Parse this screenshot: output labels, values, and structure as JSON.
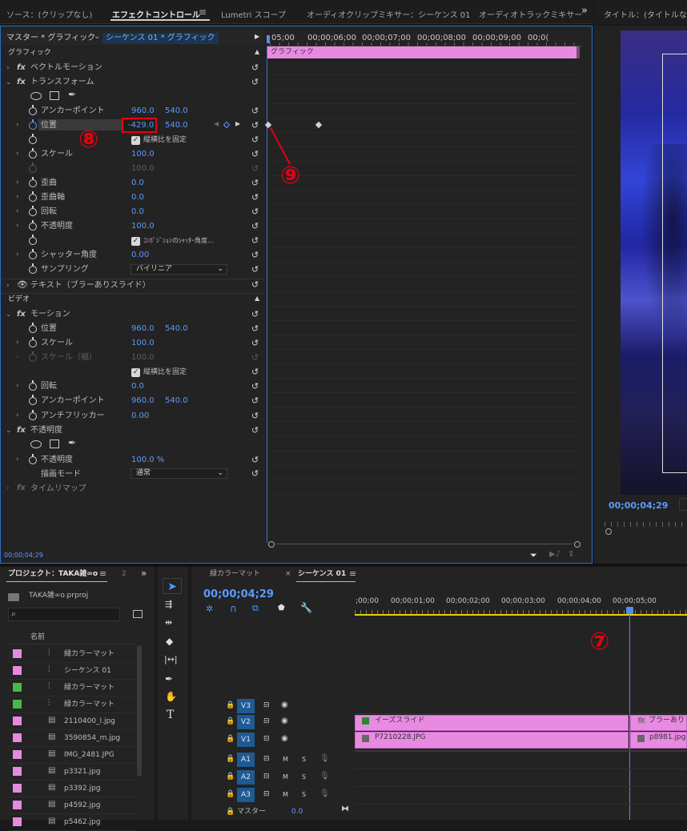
{
  "top_tabs": {
    "source": "ソース：(クリップなし)",
    "effect_controls": "エフェクトコントロール",
    "menu_glyph": "≡",
    "lumetri": "Lumetri スコープ",
    "audio_clip_mixer": "オーディオクリップミキサー：シーケンス 01",
    "audio_track_mixer": "オーディオトラックミキサー",
    "more": "»"
  },
  "program_tab": "タイトル：(タイトルなし)",
  "ec_header": {
    "master": "マスター * グラフィック",
    "chevron": "⌄",
    "sequence": "シーケンス 01 * グラフィック",
    "play_arrow": "▶"
  },
  "ec_ruler": [
    "05;00",
    "00;00;06;00",
    "00;00;07;00",
    "00;00;08;00",
    "00;00;09;00",
    "00;0("
  ],
  "graphic_clip_label": "グラフィック",
  "sections": {
    "graphic": "グラフィック",
    "video": "ビデオ"
  },
  "graphic_rows": {
    "vector_motion": "ベクトルモーション",
    "transform": "トランスフォーム",
    "anchor_point": {
      "label": "アンカーポイント",
      "x": "960.0",
      "y": "540.0"
    },
    "position": {
      "label": "位置",
      "x": "-429.0",
      "y": "540.0"
    },
    "uniform_scale": "縦横比を固定",
    "scale": {
      "label": "スケール",
      "value": "100.0"
    },
    "scale_width": {
      "value": "100.0"
    },
    "skew": {
      "label": "歪曲",
      "value": "0.0"
    },
    "skew_axis": {
      "label": "歪曲軸",
      "value": "0.0"
    },
    "rotation": {
      "label": "回転",
      "value": "0.0"
    },
    "opacity": {
      "label": "不透明度",
      "value": "100.0"
    },
    "composition_shutter": "ｺﾝﾎﾟｼﾞｼｮﾝのｼｬｯﾀｰ角度...",
    "shutter_angle": {
      "label": "シャッター角度",
      "value": "0.00"
    },
    "sampling": {
      "label": "サンプリング",
      "value": "バイリニア"
    },
    "text": "テキスト（ブラーありスライド）"
  },
  "video_rows": {
    "motion": "モーション",
    "position": {
      "label": "位置",
      "x": "960.0",
      "y": "540.0"
    },
    "scale": {
      "label": "スケール",
      "value": "100.0"
    },
    "scale_width": {
      "label": "スケール（幅）",
      "value": "100.0"
    },
    "uniform_scale": "縦横比を固定",
    "rotation": {
      "label": "回転",
      "value": "0.0"
    },
    "anchor_point": {
      "label": "アンカーポイント",
      "x": "960.0",
      "y": "540.0"
    },
    "anti_flicker": {
      "label": "アンチフリッカー",
      "value": "0.00"
    },
    "opacity_fx": "不透明度",
    "opacity": {
      "label": "不透明度",
      "value": "100.0 %"
    },
    "blend_mode": {
      "label": "描画モード",
      "value": "通常"
    },
    "time_remap": "タイムリマップ"
  },
  "ec_footer_time": "00;00;04;29",
  "program_timecode": "00;00;04;29",
  "project": {
    "tab": "プロジェクト：TAKA雑∞o",
    "menu": "≡",
    "file": "TAKA雑∞o.prproj",
    "column_name": "名前",
    "items": [
      {
        "name": "緑カラーマット",
        "color": "#e58ae0"
      },
      {
        "name": "シーケンス 01",
        "color": "#e58ae0"
      },
      {
        "name": "緑カラーマット",
        "color": "#49b849"
      },
      {
        "name": "緑カラーマット",
        "color": "#49b849"
      },
      {
        "name": "2110400_l.jpg",
        "color": "#e58ae0"
      },
      {
        "name": "3590854_m.jpg",
        "color": "#e58ae0"
      },
      {
        "name": "IMG_2481.JPG",
        "color": "#e58ae0"
      },
      {
        "name": "p3321.jpg",
        "color": "#e58ae0"
      },
      {
        "name": "p3392.jpg",
        "color": "#e58ae0"
      },
      {
        "name": "p4592.jpg",
        "color": "#e58ae0"
      },
      {
        "name": "p5462.jpg",
        "color": "#e58ae0"
      }
    ]
  },
  "timeline": {
    "tab1": "緑カラーマット",
    "close": "×",
    "tab2": "シーケンス 01",
    "menu": "≡",
    "timecode": "00;00;04;29",
    "ruler": [
      ";00;00",
      "00;00;01;00",
      "00;00;02;00",
      "00;00;03;00",
      "00;00;04;00",
      "00;00;05;00"
    ],
    "tracks": {
      "v3": "V3",
      "v2": "V2",
      "v1": "V1",
      "a1": "A1",
      "a2": "A2",
      "a3": "A3",
      "m": "M",
      "s": "S",
      "master": "マスター",
      "master_value": "0.0"
    },
    "clips": {
      "v2_clip_a": "イーズスライド",
      "v2_clip_b": "ブラーあり",
      "v1_clip_a": "P7210228.JPG",
      "v1_clip_b": "p8981.jpg"
    }
  },
  "annotations": {
    "eight": "⑧",
    "nine": "⑨",
    "seven": "⑦"
  }
}
